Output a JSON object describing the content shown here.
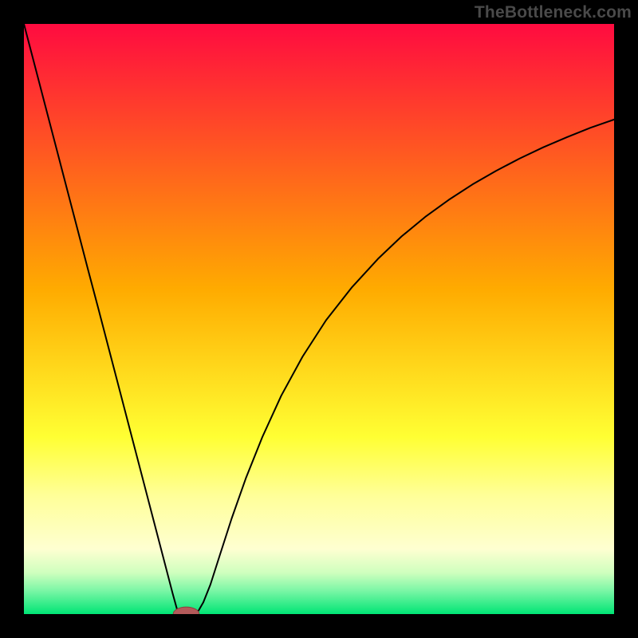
{
  "watermark": "TheBottleneck.com",
  "chart_data": {
    "type": "line",
    "title": "",
    "xlabel": "",
    "ylabel": "",
    "xlim": [
      0,
      100
    ],
    "ylim": [
      0,
      100
    ],
    "background_gradient": {
      "stops": [
        {
          "offset": 0.0,
          "color": "#ff0b40"
        },
        {
          "offset": 0.45,
          "color": "#ffab00"
        },
        {
          "offset": 0.7,
          "color": "#ffff33"
        },
        {
          "offset": 0.8,
          "color": "#ffff99"
        },
        {
          "offset": 0.89,
          "color": "#feffd1"
        },
        {
          "offset": 0.93,
          "color": "#cfffbe"
        },
        {
          "offset": 0.96,
          "color": "#7cf6a6"
        },
        {
          "offset": 1.0,
          "color": "#00e575"
        }
      ]
    },
    "series": [
      {
        "name": "bottleneck-curve",
        "color": "#000000",
        "stroke_width": 2,
        "x": [
          0.0,
          1.8,
          3.6,
          5.4,
          7.2,
          9.0,
          10.8,
          12.6,
          14.4,
          16.2,
          18.0,
          19.8,
          21.6,
          23.4,
          25.2,
          26.0,
          26.4,
          26.8,
          27.2,
          27.6,
          28.2,
          28.6,
          29.0,
          29.6,
          30.4,
          31.6,
          33.2,
          35.2,
          37.6,
          40.4,
          43.6,
          47.2,
          51.2,
          55.6,
          60.0,
          64.0,
          68.0,
          72.0,
          76.0,
          80.0,
          84.0,
          88.0,
          92.0,
          96.0,
          100.0
        ],
        "y": [
          100.0,
          93.1,
          86.2,
          79.3,
          72.4,
          65.5,
          58.6,
          51.8,
          44.9,
          38.0,
          31.1,
          24.2,
          17.3,
          10.4,
          3.5,
          0.6,
          0.3,
          0.18,
          0.12,
          0.1,
          0.1,
          0.12,
          0.2,
          0.6,
          2.0,
          5.0,
          10.0,
          16.2,
          23.0,
          30.0,
          37.0,
          43.6,
          49.8,
          55.4,
          60.2,
          64.0,
          67.3,
          70.2,
          72.8,
          75.1,
          77.2,
          79.1,
          80.8,
          82.4,
          83.8
        ]
      }
    ],
    "marker": {
      "name": "sweet-spot",
      "cx": 27.5,
      "cy": 0.0,
      "rx": 2.2,
      "ry": 1.2,
      "fill": "#b35a5a",
      "stroke": "#8c3e3e"
    }
  }
}
